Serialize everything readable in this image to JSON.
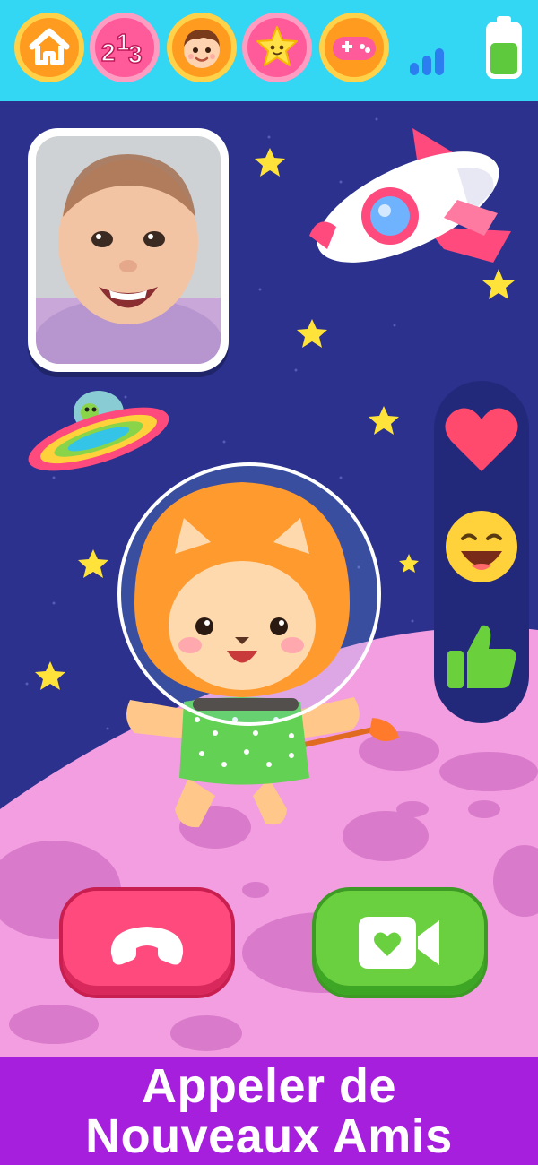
{
  "topbar": {
    "nav": [
      {
        "name": "home",
        "icon": "home-icon",
        "color": "#ff9b1e"
      },
      {
        "name": "numbers",
        "icon": "numbers-123-icon",
        "label": "213",
        "color": "#ff5a9a"
      },
      {
        "name": "boy",
        "icon": "boy-face-icon",
        "color": "#ff9b1e"
      },
      {
        "name": "star",
        "icon": "smiling-star-icon",
        "color": "#ff5a9a"
      },
      {
        "name": "games",
        "icon": "gamepad-icon",
        "color": "#ff9b1e"
      }
    ],
    "signal_icon": "signal-bars-icon",
    "battery_icon": "battery-icon"
  },
  "scene": {
    "caller_photo": "baby-photo",
    "reactions": [
      {
        "name": "heart",
        "icon": "heart-icon"
      },
      {
        "name": "smile",
        "icon": "laughing-emoji-icon"
      },
      {
        "name": "like",
        "icon": "thumbs-up-icon"
      }
    ],
    "hangup_icon": "hang-up-phone-icon",
    "video_icon": "video-call-heart-icon"
  },
  "banner": {
    "line1": "Appeler de",
    "line2": "Nouveaux Amis"
  },
  "colors": {
    "topbar": "#33d6f3",
    "sky": "#2b318c",
    "planet": "#f29ee0",
    "hangup": "#ff4a7d",
    "video": "#6bd03f",
    "banner": "#a51fdd"
  }
}
